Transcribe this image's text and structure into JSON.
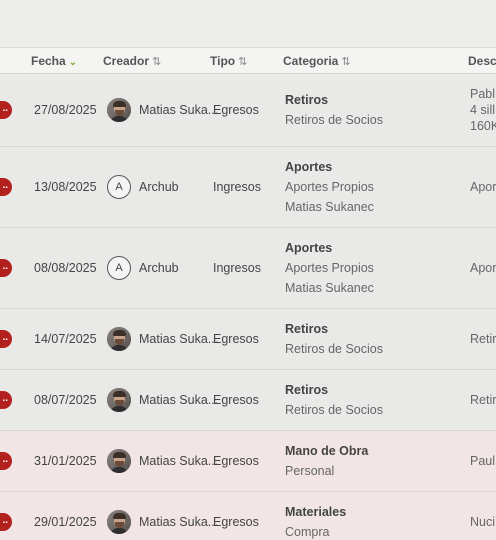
{
  "header": {
    "fecha": "Fecha",
    "creador": "Creador",
    "tipo": "Tipo",
    "categoria": "Categoria",
    "descripcion": "Desc",
    "sort_icon": "⇅",
    "chevron": "⌄"
  },
  "rows": [
    {
      "badge": "..",
      "fecha": "27/08/2025",
      "creador": "Matias Suka...",
      "avatar": "photo",
      "tipo": "Egresos",
      "categoria": "Retiros",
      "sub1": "Retiros de Socios",
      "sub2": "",
      "desc1": "Pabl",
      "desc2": "4 sill",
      "desc3": "160K",
      "pink": false
    },
    {
      "badge": "..",
      "fecha": "13/08/2025",
      "creador": "Archub",
      "avatar": "A",
      "tipo": "Ingresos",
      "categoria": "Aportes",
      "sub1": "Aportes Propios",
      "sub2": "Matias Sukanec",
      "desc1": "Apor",
      "desc2": "",
      "desc3": "",
      "pink": false
    },
    {
      "badge": "..",
      "fecha": "08/08/2025",
      "creador": "Archub",
      "avatar": "A",
      "tipo": "Ingresos",
      "categoria": "Aportes",
      "sub1": "Aportes Propios",
      "sub2": "Matias Sukanec",
      "desc1": "Apor",
      "desc2": "",
      "desc3": "",
      "pink": false
    },
    {
      "badge": "..",
      "fecha": "14/07/2025",
      "creador": "Matias Suka...",
      "avatar": "photo",
      "tipo": "Egresos",
      "categoria": "Retiros",
      "sub1": "Retiros de Socios",
      "sub2": "",
      "desc1": "Retir",
      "desc2": "",
      "desc3": "",
      "pink": false
    },
    {
      "badge": "..",
      "fecha": "08/07/2025",
      "creador": "Matias Suka...",
      "avatar": "photo",
      "tipo": "Egresos",
      "categoria": "Retiros",
      "sub1": "Retiros de Socios",
      "sub2": "",
      "desc1": "Retir",
      "desc2": "",
      "desc3": "",
      "pink": false
    },
    {
      "badge": "..",
      "fecha": "31/01/2025",
      "creador": "Matias Suka...",
      "avatar": "photo",
      "tipo": "Egresos",
      "categoria": "Mano de Obra",
      "sub1": "Personal",
      "sub2": "",
      "desc1": "Paul",
      "desc2": "",
      "desc3": "",
      "pink": true
    },
    {
      "badge": "..",
      "fecha": "29/01/2025",
      "creador": "Matias Suka...",
      "avatar": "photo",
      "tipo": "Egresos",
      "categoria": "Materiales",
      "sub1": "Compra",
      "sub2": "",
      "desc1": "Nuci",
      "desc2": "",
      "desc3": "",
      "pink": true
    }
  ]
}
